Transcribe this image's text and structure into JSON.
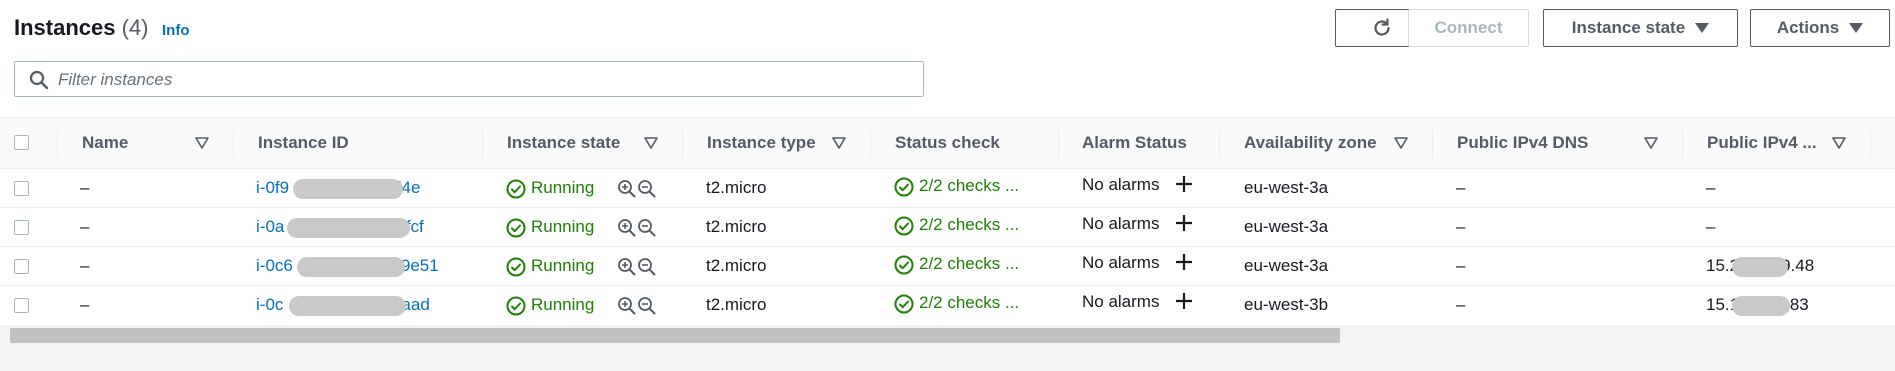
{
  "header": {
    "title": "Instances",
    "count": "(4)",
    "info_label": "Info",
    "connect_label": "Connect",
    "instance_state_label": "Instance state",
    "actions_label": "Actions"
  },
  "search": {
    "placeholder": "Filter instances"
  },
  "columns": {
    "name": "Name",
    "instance_id": "Instance ID",
    "instance_state": "Instance state",
    "instance_type": "Instance type",
    "status_check": "Status check",
    "alarm_status": "Alarm Status",
    "availability_zone": "Availability zone",
    "public_ipv4_dns": "Public IPv4 DNS",
    "public_ipv4": "Public IPv4 ..."
  },
  "rows": [
    {
      "name": "–",
      "id_start": "i-0f9",
      "id_end": "d4e",
      "state": "Running",
      "type": "t2.micro",
      "status": "2/2 checks ...",
      "alarm": "No alarms",
      "zone": "eu-west-3a",
      "dns": "–",
      "ip_start": "–",
      "ip_end": ""
    },
    {
      "name": "–",
      "id_start": "i-0a",
      "id_end": "bfcf",
      "state": "Running",
      "type": "t2.micro",
      "status": "2/2 checks ...",
      "alarm": "No alarms",
      "zone": "eu-west-3a",
      "dns": "–",
      "ip_start": "–",
      "ip_end": ""
    },
    {
      "name": "–",
      "id_start": "i-0c6",
      "id_end": "9e51",
      "state": "Running",
      "type": "t2.micro",
      "status": "2/2 checks ...",
      "alarm": "No alarms",
      "zone": "eu-west-3a",
      "dns": "–",
      "ip_start": "15.2",
      "ip_end": "9.48"
    },
    {
      "name": "–",
      "id_start": "i-0c",
      "id_end": "aad",
      "state": "Running",
      "type": "t2.micro",
      "status": "2/2 checks ...",
      "alarm": "No alarms",
      "zone": "eu-west-3b",
      "dns": "–",
      "ip_start": "15.1",
      "ip_end": ".83"
    }
  ],
  "icons": {
    "refresh": "refresh-icon",
    "search": "search-icon",
    "sort": "sort-down-icon",
    "running": "check-circle-icon",
    "zoom_in": "zoom-in-icon",
    "zoom_out": "zoom-out-icon",
    "add": "plus-icon"
  },
  "colors": {
    "link": "#0073bb",
    "success": "#1d8102",
    "text": "#16191f",
    "muted": "#545b64"
  }
}
